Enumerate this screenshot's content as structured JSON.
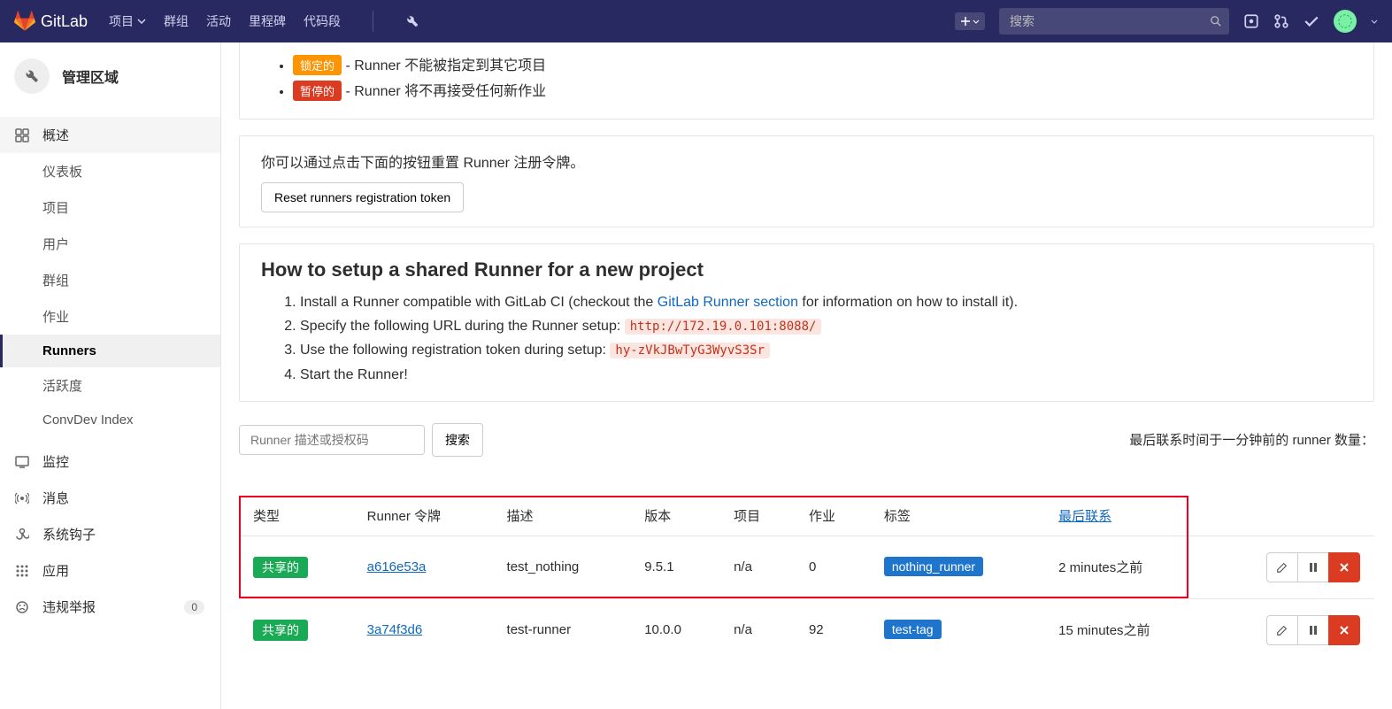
{
  "header": {
    "brand": "GitLab",
    "nav": {
      "projects": "项目",
      "groups": "群组",
      "activity": "活动",
      "milestones": "里程碑",
      "snippets": "代码段"
    },
    "search_placeholder": "搜索"
  },
  "sidebar": {
    "area_title": "管理区域",
    "overview": {
      "label": "概述",
      "items": {
        "dashboard": "仪表板",
        "projects": "项目",
        "users": "用户",
        "groups": "群组",
        "jobs": "作业",
        "runners": "Runners",
        "activity": "活跃度",
        "convdev": "ConvDev Index"
      }
    },
    "monitor": "监控",
    "messages": "消息",
    "hooks": "系统钩子",
    "apps": "应用",
    "abuse": {
      "label": "违规举报",
      "badge": "0"
    }
  },
  "badges": {
    "locked": {
      "label": "锁定的",
      "desc": " - Runner 不能被指定到其它项目"
    },
    "paused": {
      "label": "暂停的",
      "desc": " - Runner 将不再接受任何新作业"
    }
  },
  "reset_section": {
    "text": "你可以通过点击下面的按钮重置 Runner 注册令牌。",
    "button": "Reset runners registration token"
  },
  "howto": {
    "title": "How to setup a shared Runner for a new project",
    "step1a": "Install a Runner compatible with GitLab CI (checkout the ",
    "step1link": "GitLab Runner section",
    "step1b": " for information on how to install it).",
    "step2a": "Specify the following URL during the Runner setup: ",
    "step2code": "http://172.19.0.101:8088/",
    "step3a": "Use the following registration token during setup: ",
    "step3code": "hy-zVkJBwTyG3WyvS3Sr",
    "step4": "Start the Runner!"
  },
  "filter": {
    "placeholder": "Runner 描述或授权码",
    "button": "搜索",
    "info": "最后联系时间于一分钟前的 runner 数量："
  },
  "table": {
    "headers": {
      "type": "类型",
      "token": "Runner 令牌",
      "desc": "描述",
      "version": "版本",
      "projects": "项目",
      "jobs": "作业",
      "tags": "标签",
      "last": "最后联系"
    },
    "shared_label": "共享的",
    "rows": [
      {
        "token": "a616e53a",
        "desc": "test_nothing",
        "version": "9.5.1",
        "projects": "n/a",
        "jobs": "0",
        "tag": "nothing_runner",
        "last": "2 minutes之前"
      },
      {
        "token": "3a74f3d6",
        "desc": "test-runner",
        "version": "10.0.0",
        "projects": "n/a",
        "jobs": "92",
        "tag": "test-tag",
        "last": "15 minutes之前"
      }
    ]
  }
}
